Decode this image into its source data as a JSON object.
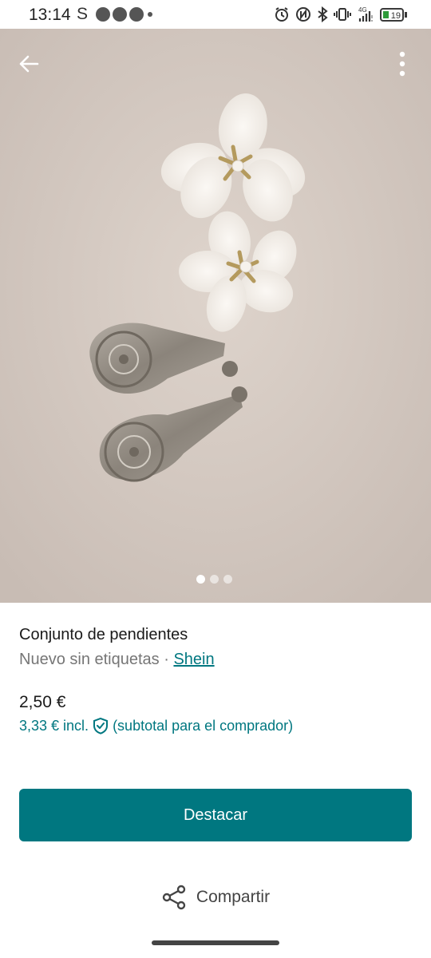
{
  "status_bar": {
    "time": "13:14",
    "carrier_letter": "S",
    "network": "4G",
    "battery": "19"
  },
  "gallery": {
    "page_count": 3,
    "current_page": 1
  },
  "item": {
    "title": "Conjunto de pendientes",
    "condition": "Nuevo sin etiquetas",
    "separator": " · ",
    "brand": "Shein",
    "price": "2,50 €",
    "price_incl": "3,33 €  incl.",
    "price_incl_note": "(subtotal para el comprador)"
  },
  "actions": {
    "primary_label": "Destacar",
    "share_label": "Compartir"
  },
  "colors": {
    "accent": "#007780",
    "text": "#1a1a1a",
    "muted": "#767676"
  },
  "icons": [
    "back-arrow-icon",
    "more-vertical-icon",
    "shield-check-icon",
    "share-icon"
  ]
}
